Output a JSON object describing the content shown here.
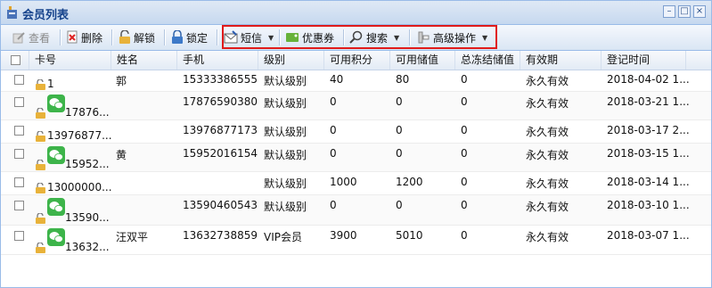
{
  "window": {
    "title": "会员列表"
  },
  "toolbar": {
    "view": "查看",
    "delete": "删除",
    "unlock": "解锁",
    "lock": "锁定",
    "sms": "短信",
    "coupon": "优惠券",
    "search": "搜索",
    "advanced": "高级操作"
  },
  "columns": [
    "卡号",
    "姓名",
    "手机",
    "级别",
    "可用积分",
    "可用储值",
    "总冻结储值",
    "有效期",
    "登记时间"
  ],
  "rows": [
    {
      "card": "1",
      "name": "郭",
      "phone": "15333386555",
      "level": "默认级别",
      "points": "40",
      "balance": "80",
      "frozen": "0",
      "validity": "永久有效",
      "registered": "2018-04-02 1...",
      "wechat": false
    },
    {
      "card": "17876...",
      "name": "",
      "phone": "17876590380",
      "level": "默认级别",
      "points": "0",
      "balance": "0",
      "frozen": "0",
      "validity": "永久有效",
      "registered": "2018-03-21 1...",
      "wechat": true
    },
    {
      "card": "13976877...",
      "name": "",
      "phone": "13976877173",
      "level": "默认级别",
      "points": "0",
      "balance": "0",
      "frozen": "0",
      "validity": "永久有效",
      "registered": "2018-03-17 2...",
      "wechat": false
    },
    {
      "card": "15952...",
      "name": "黄",
      "phone": "15952016154",
      "level": "默认级别",
      "points": "0",
      "balance": "0",
      "frozen": "0",
      "validity": "永久有效",
      "registered": "2018-03-15 1...",
      "wechat": true
    },
    {
      "card": "13000000...",
      "name": "",
      "phone": "",
      "level": "默认级别",
      "points": "1000",
      "balance": "1200",
      "frozen": "0",
      "validity": "永久有效",
      "registered": "2018-03-14 1...",
      "wechat": false
    },
    {
      "card": "13590...",
      "name": "",
      "phone": "13590460543",
      "level": "默认级别",
      "points": "0",
      "balance": "0",
      "frozen": "0",
      "validity": "永久有效",
      "registered": "2018-03-10 1...",
      "wechat": true
    },
    {
      "card": "13632...",
      "name": "汪双平",
      "phone": "13632738859",
      "level": "VIP会员",
      "points": "3900",
      "balance": "5010",
      "frozen": "0",
      "validity": "永久有效",
      "registered": "2018-03-07 1...",
      "wechat": true
    }
  ],
  "colors": {
    "highlight_box": "#e01b1b",
    "wechat_green": "#3db44a",
    "lock_gold": "#e8b23a",
    "title_blue": "#15428b"
  }
}
